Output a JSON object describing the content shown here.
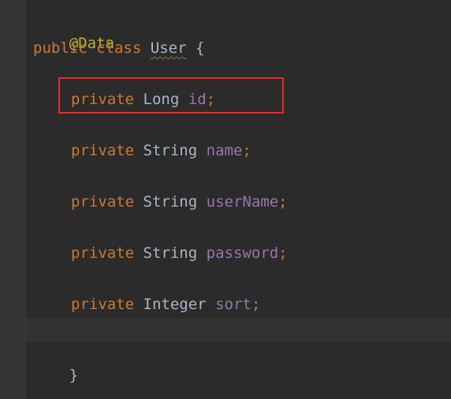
{
  "code": {
    "annotation": "@Data",
    "class_decl": {
      "kw_public": "public",
      "kw_class": "class",
      "class_name": "User",
      "open_brace": "{"
    },
    "fields": [
      {
        "modifier": "private",
        "type": "Long",
        "name": "id",
        "semicolon": ";"
      },
      {
        "modifier": "private",
        "type": "String",
        "name": "name",
        "semicolon": ";"
      },
      {
        "modifier": "private",
        "type": "String",
        "name": "userName",
        "semicolon": ";"
      },
      {
        "modifier": "private",
        "type": "String",
        "name": "password",
        "semicolon": ";"
      },
      {
        "modifier": "private",
        "type": "Integer",
        "name": "sort",
        "semicolon": ";"
      }
    ],
    "close_brace": "}"
  },
  "colors": {
    "background": "#2b2b2b",
    "keyword": "#cc7832",
    "annotation": "#bbb529",
    "field": "#9876aa",
    "plain": "#a9b7c6",
    "highlight_border": "#e32d2d"
  }
}
